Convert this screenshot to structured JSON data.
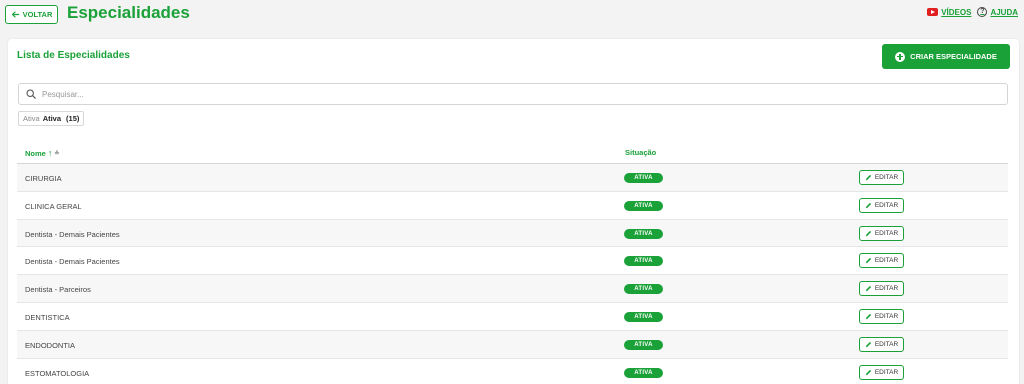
{
  "header": {
    "back_label": "VOLTAR",
    "title": "Especialidades",
    "videos_label": "VÍDEOS",
    "help_label": "AJUDA"
  },
  "card": {
    "title": "Lista de Especialidades",
    "create_label": "CRIAR ESPECIALIDADE"
  },
  "search": {
    "placeholder": "Pesquisar..."
  },
  "filter": {
    "label": "Ativa",
    "value": "Ativa",
    "count": "(15)"
  },
  "table": {
    "columns": {
      "name": "Nome",
      "status": "Situação"
    },
    "rows": [
      {
        "name": "CIRURGIA",
        "status": "ATIVA",
        "action": "EDITAR"
      },
      {
        "name": "CLINICA GERAL",
        "status": "ATIVA",
        "action": "EDITAR"
      },
      {
        "name": "Dentista - Demais Pacientes",
        "status": "ATIVA",
        "action": "EDITAR"
      },
      {
        "name": "Dentista - Demais Pacientes",
        "status": "ATIVA",
        "action": "EDITAR"
      },
      {
        "name": "Dentista - Parceiros",
        "status": "ATIVA",
        "action": "EDITAR"
      },
      {
        "name": "DENTISTICA",
        "status": "ATIVA",
        "action": "EDITAR"
      },
      {
        "name": "ENDODONTIA",
        "status": "ATIVA",
        "action": "EDITAR"
      },
      {
        "name": "ESTOMATOLOGIA",
        "status": "ATIVA",
        "action": "EDITAR"
      }
    ]
  },
  "colors": {
    "accent": "#1aa138",
    "youtube": "#e02020"
  },
  "icons": [
    "arrow-left-icon",
    "youtube-icon",
    "help-icon",
    "plus-circle-icon",
    "search-icon",
    "sort-icon",
    "pencil-icon"
  ]
}
